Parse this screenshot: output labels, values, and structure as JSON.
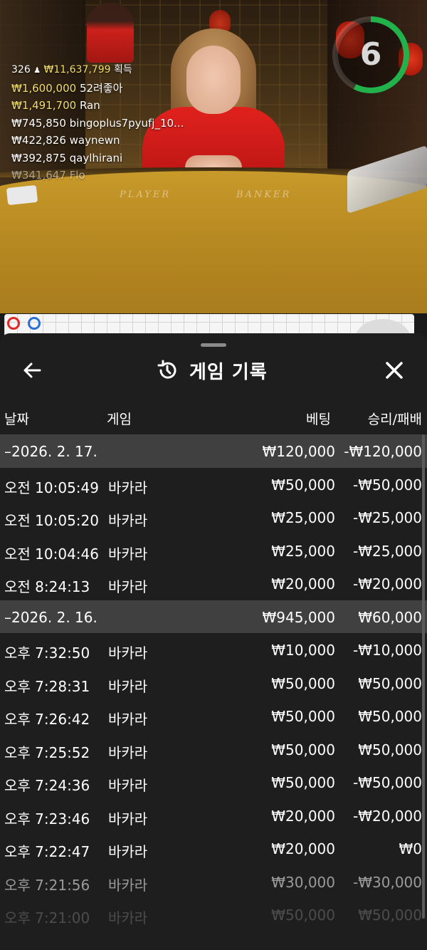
{
  "live": {
    "timer": "6",
    "table_labels": [
      "PLAYER",
      "BANKER"
    ],
    "winners_header": {
      "count": "326",
      "amount": "₩11,637,799",
      "suffix": "획득"
    },
    "winners": [
      {
        "amount": "₩1,600,000",
        "name": "52려좋아"
      },
      {
        "amount": "₩1,491,700",
        "name": "Ran"
      },
      {
        "amount": "₩745,850",
        "name": "bingoplus7pyufj_10..."
      },
      {
        "amount": "₩422,826",
        "name": "waynewn"
      },
      {
        "amount": "₩392,875",
        "name": "qaylhirani"
      },
      {
        "amount": "₩341,647",
        "name": "Flo"
      }
    ],
    "roadmap_colors": {
      "banker": "#e02828",
      "player": "#2a6fd6"
    }
  },
  "sheet": {
    "title": "게임 기록",
    "columns": {
      "date": "날짜",
      "game": "게임",
      "bet": "베팅",
      "result": "승리/패배"
    },
    "rows": [
      {
        "type": "group",
        "date": "–2026. 2. 17.",
        "game": "",
        "bet": "₩120,000",
        "result": "-₩120,000"
      },
      {
        "type": "item",
        "date": "오전 10:05:49",
        "game": "바카라",
        "bet": "₩50,000",
        "result": "-₩50,000"
      },
      {
        "type": "item",
        "date": "오전 10:05:20",
        "game": "바카라",
        "bet": "₩25,000",
        "result": "-₩25,000"
      },
      {
        "type": "item",
        "date": "오전 10:04:46",
        "game": "바카라",
        "bet": "₩25,000",
        "result": "-₩25,000"
      },
      {
        "type": "item",
        "date": "오전 8:24:13",
        "game": "바카라",
        "bet": "₩20,000",
        "result": "-₩20,000"
      },
      {
        "type": "group",
        "date": "–2026. 2. 16.",
        "game": "",
        "bet": "₩945,000",
        "result": "₩60,000"
      },
      {
        "type": "item",
        "date": "오후 7:32:50",
        "game": "바카라",
        "bet": "₩10,000",
        "result": "-₩10,000"
      },
      {
        "type": "item",
        "date": "오후 7:28:31",
        "game": "바카라",
        "bet": "₩50,000",
        "result": "₩50,000"
      },
      {
        "type": "item",
        "date": "오후 7:26:42",
        "game": "바카라",
        "bet": "₩50,000",
        "result": "₩50,000"
      },
      {
        "type": "item",
        "date": "오후 7:25:52",
        "game": "바카라",
        "bet": "₩50,000",
        "result": "₩50,000"
      },
      {
        "type": "item",
        "date": "오후 7:24:36",
        "game": "바카라",
        "bet": "₩50,000",
        "result": "-₩50,000"
      },
      {
        "type": "item",
        "date": "오후 7:23:46",
        "game": "바카라",
        "bet": "₩20,000",
        "result": "-₩20,000"
      },
      {
        "type": "item",
        "date": "오후 7:22:47",
        "game": "바카라",
        "bet": "₩20,000",
        "result": "₩0"
      },
      {
        "type": "item",
        "date": "오후 7:21:56",
        "game": "바카라",
        "bet": "₩30,000",
        "result": "-₩30,000"
      },
      {
        "type": "item",
        "date": "오후 7:21:00",
        "game": "바카라",
        "bet": "₩50,000",
        "result": "₩50,000"
      }
    ]
  }
}
